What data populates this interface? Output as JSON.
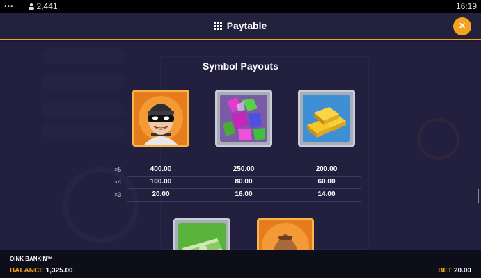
{
  "status_bar": {
    "menu_dots": "•••",
    "user_count": "2,441",
    "time": "16:19"
  },
  "header": {
    "title": "Paytable",
    "close_label": "×"
  },
  "paytable": {
    "section_title": "Symbol Payouts",
    "multipliers": [
      "×5",
      "×4",
      "×3"
    ],
    "symbols": [
      {
        "icon": "robber-icon",
        "payouts": [
          "400.00",
          "100.00",
          "20.00"
        ]
      },
      {
        "icon": "gems-icon",
        "payouts": [
          "250.00",
          "80.00",
          "16.00"
        ]
      },
      {
        "icon": "gold-bars-icon",
        "payouts": [
          "200.00",
          "60.00",
          "14.00"
        ]
      }
    ],
    "next_row_icons": [
      "cash-stack-icon",
      "money-bag-icon"
    ]
  },
  "footer": {
    "game_name": "OINK BANKIN™",
    "balance_label": "BALANCE",
    "balance_value": "1,325.00",
    "bet_label": "BET",
    "bet_value": "20.00"
  },
  "colors": {
    "accent": "#f3a41c",
    "background": "#22203e",
    "header": "#23213d"
  }
}
